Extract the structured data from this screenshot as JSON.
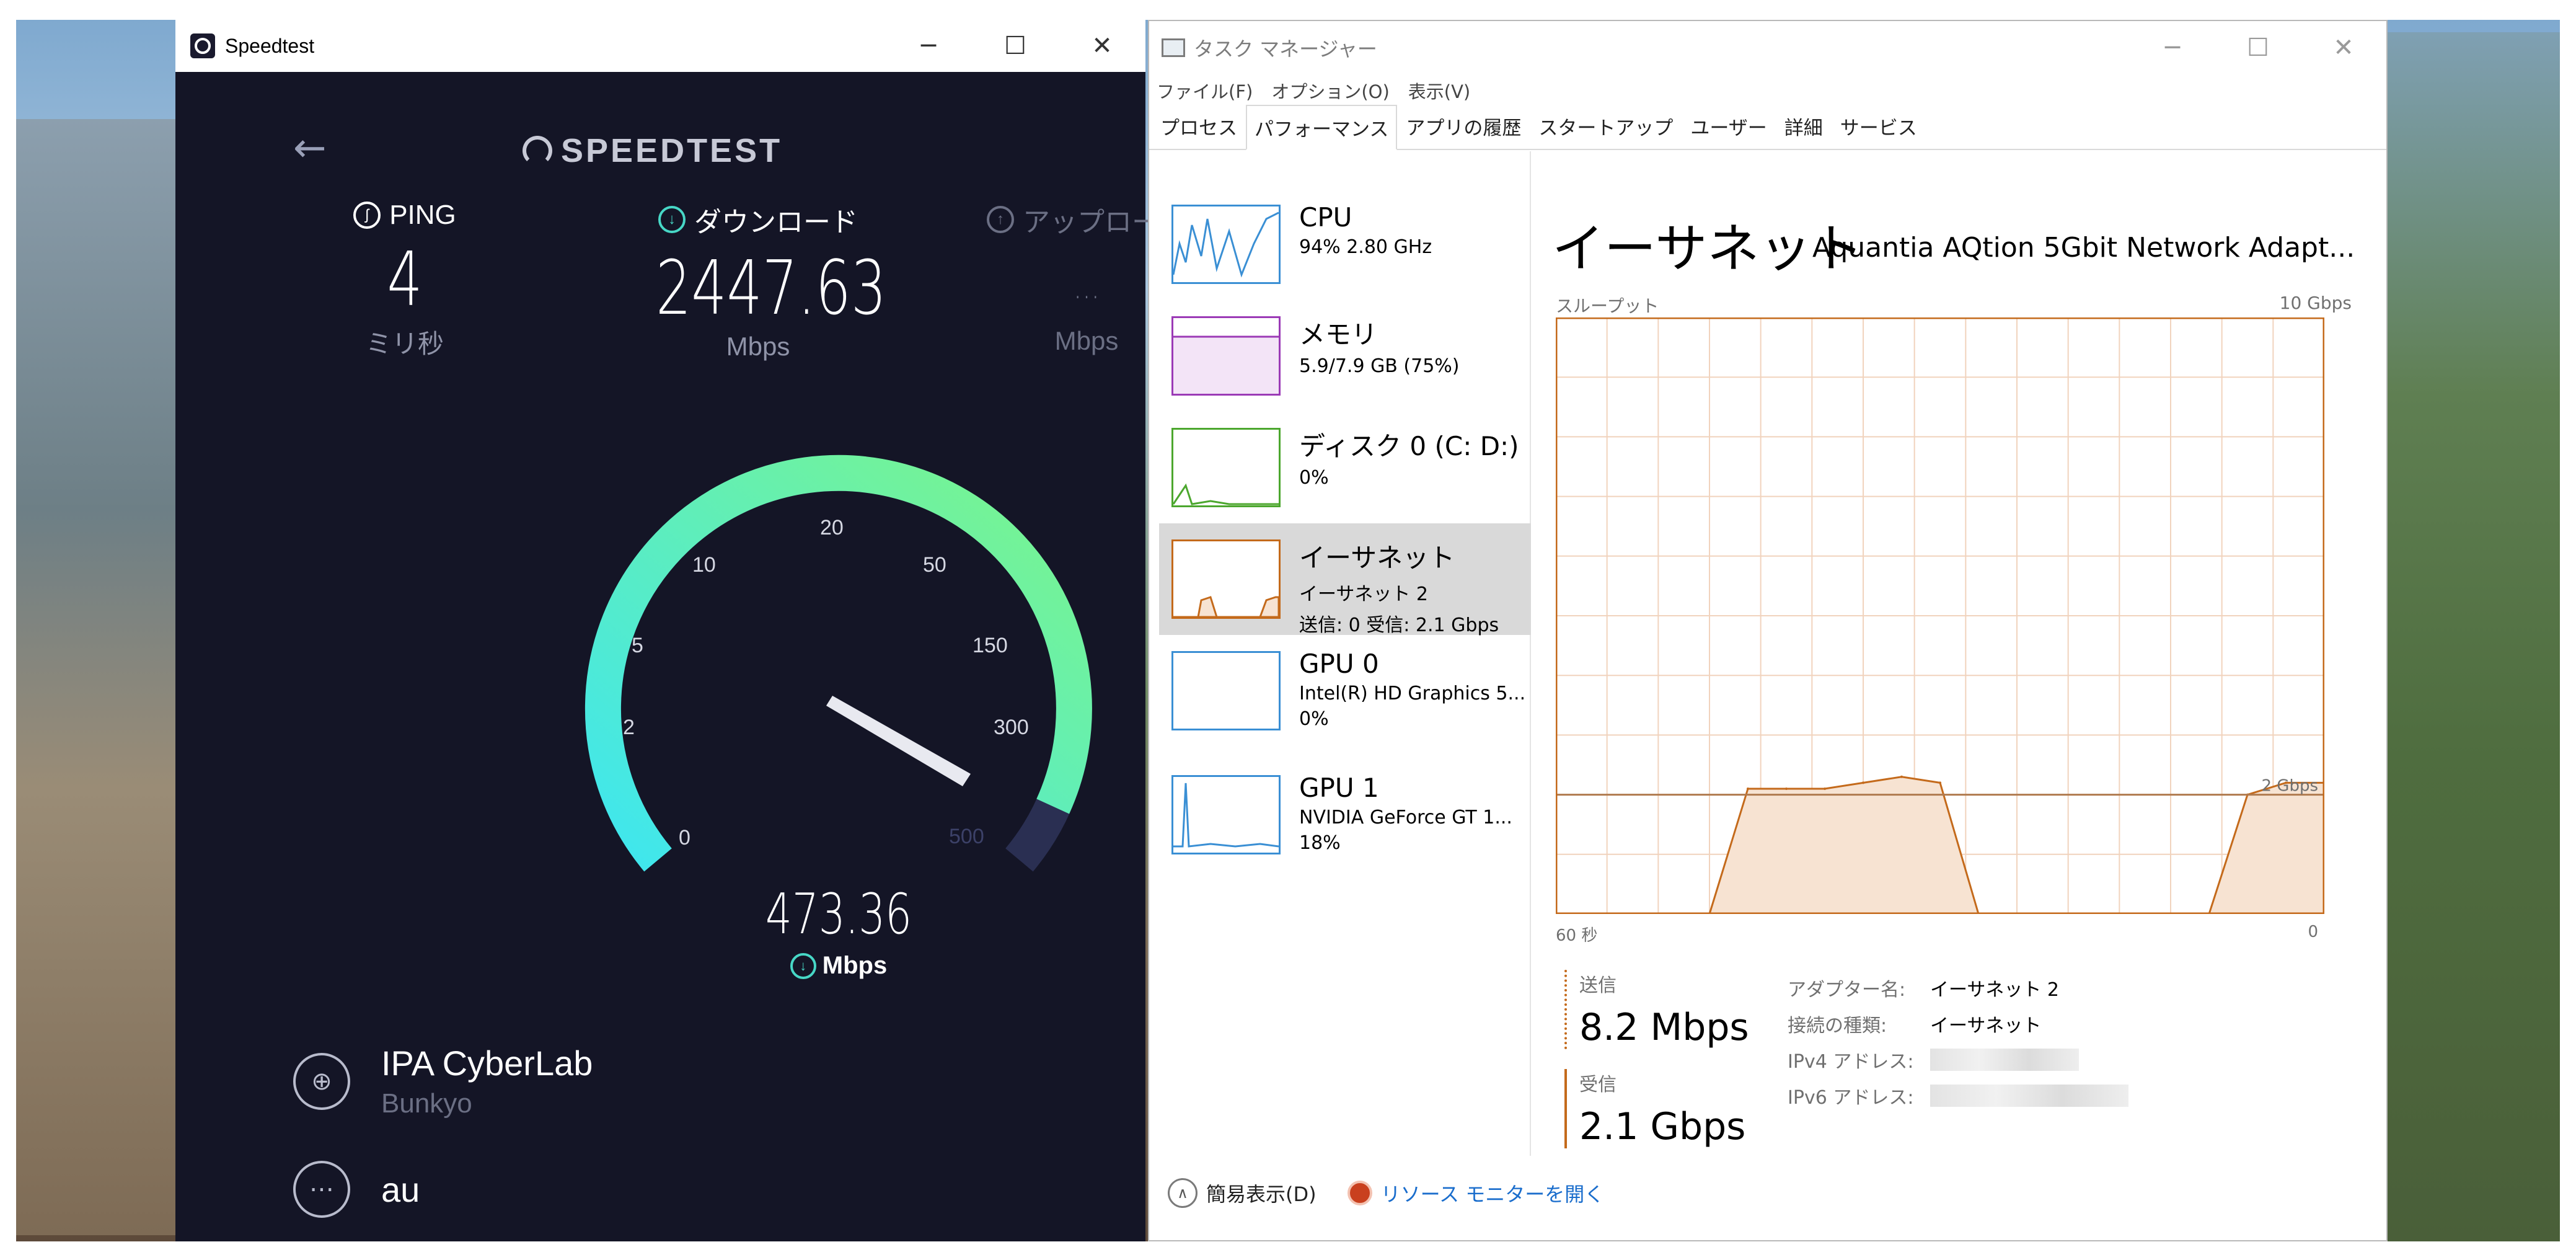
{
  "speedtest": {
    "window_title": "Speedtest",
    "logo_text": "SPEEDTEST",
    "ping": {
      "label": "PING",
      "value": "4",
      "unit": "ミリ秒"
    },
    "download": {
      "label": "ダウンロード",
      "value": "2447.63",
      "unit": "Mbps"
    },
    "upload": {
      "label": "アップロード",
      "value": "...",
      "unit": "Mbps"
    },
    "gauge": {
      "ticks": [
        "0",
        "2",
        "5",
        "10",
        "20",
        "50",
        "150",
        "300",
        "500"
      ],
      "current_value": "473.36",
      "current_unit": "Mbps"
    },
    "server": {
      "name": "IPA CyberLab",
      "location": "Bunkyo"
    },
    "isp": {
      "name": "au"
    }
  },
  "taskmgr": {
    "window_title": "タスク マネージャー",
    "menu": [
      "ファイル(F)",
      "オプション(O)",
      "表示(V)"
    ],
    "tabs": [
      "プロセス",
      "パフォーマンス",
      "アプリの履歴",
      "スタートアップ",
      "ユーザー",
      "詳細",
      "サービス"
    ],
    "active_tab": "パフォーマンス",
    "resources": [
      {
        "name": "CPU",
        "sub1": "94%  2.80 GHz",
        "sub2": ""
      },
      {
        "name": "メモリ",
        "sub1": "5.9/7.9 GB (75%)",
        "sub2": ""
      },
      {
        "name": "ディスク 0 (C: D:)",
        "sub1": "0%",
        "sub2": ""
      },
      {
        "name": "イーサネット",
        "sub1": "イーサネット 2",
        "sub2": "送信: 0  受信: 2.1 Gbps"
      },
      {
        "name": "GPU 0",
        "sub1": "Intel(R) HD Graphics 5...",
        "sub2": "0%"
      },
      {
        "name": "GPU 1",
        "sub1": "NVIDIA GeForce GT 1...",
        "sub2": "18%"
      }
    ],
    "selected_resource": "イーサネット",
    "detail": {
      "title": "イーサネット",
      "adapter": "Aquantia AQtion 5Gbit Network Adapt...",
      "throughput_label": "スループット",
      "max_label": "10 Gbps",
      "line_label": "2 Gbps",
      "x_min_label": "60 秒",
      "x_max_label": "0",
      "send_label": "送信",
      "send_value": "8.2 Mbps",
      "recv_label": "受信",
      "recv_value": "2.1 Gbps",
      "props": {
        "adapter_label": "アダプター名:",
        "adapter_value": "イーサネット 2",
        "conn_type_label": "接続の種類:",
        "conn_type_value": "イーサネット",
        "ipv4_label": "IPv4 アドレス:",
        "ipv6_label": "IPv6 アドレス:"
      }
    },
    "footer": {
      "fewer_details": "簡易表示(D)",
      "resmon_link": "リソース モニターを開く"
    }
  },
  "chart_data": {
    "type": "area",
    "title": "",
    "ylabel": "スループット",
    "ylim": [
      0,
      10
    ],
    "xlim": [
      60,
      0
    ],
    "x": [
      60,
      57,
      54,
      51,
      48,
      45,
      42,
      39,
      36,
      33,
      30,
      27,
      24,
      21,
      18,
      15,
      12,
      9,
      6,
      3,
      0
    ],
    "series": [
      {
        "values": [
          0,
          0,
          0,
          0,
          0,
          2.1,
          2.1,
          2.1,
          2.2,
          2.3,
          2.2,
          0,
          0,
          0,
          0,
          0,
          0,
          0,
          2.0,
          2.2,
          2.2
        ]
      }
    ],
    "reference_line": 2,
    "colors": {
      "line": "#c46a1b",
      "fill": "#f7e3d2",
      "grid": "#f1d3bd"
    }
  }
}
